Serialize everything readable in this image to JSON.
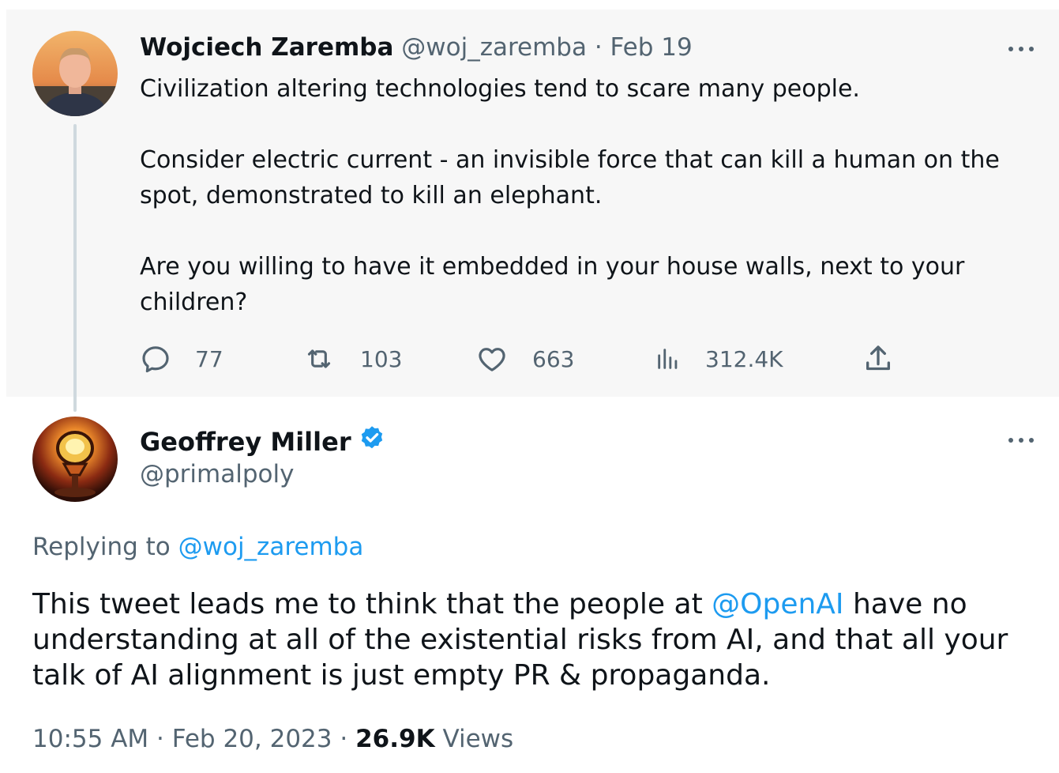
{
  "parent": {
    "name": "Wojciech Zaremba",
    "handle": "@woj_zaremba",
    "separator": " · ",
    "date": "Feb 19",
    "avatar_icon": "profile-photo",
    "lines": [
      "Civilization altering technologies tend to scare many people.",
      "Consider electric current - an invisible force that can kill a human on the spot, demonstrated to kill an elephant.",
      "Are you willing to have it embedded in your house walls, next to your children?"
    ],
    "actions": {
      "replies": "77",
      "retweets": "103",
      "likes": "663",
      "views": "312.4K"
    }
  },
  "reply": {
    "name": "Geoffrey Miller",
    "handle": "@primalpoly",
    "avatar_icon": "profile-photo",
    "replying_label": "Replying to ",
    "replying_handle": "@woj_zaremba",
    "text_before": "This tweet leads me to think that the people at ",
    "mention": "@OpenAI",
    "text_after": " have no understanding at all of the existential risks from AI, and that all your talk of AI alignment is just empty PR & propaganda.",
    "time": "10:55 AM",
    "date": "Feb 20, 2023",
    "views_count": "26.9K",
    "views_label": "Views"
  },
  "colors": {
    "text": "#0f1419",
    "muted": "#536471",
    "link": "#1d9bf0",
    "parent_bg": "#f7f7f7",
    "thread_line": "#cfd9de"
  }
}
